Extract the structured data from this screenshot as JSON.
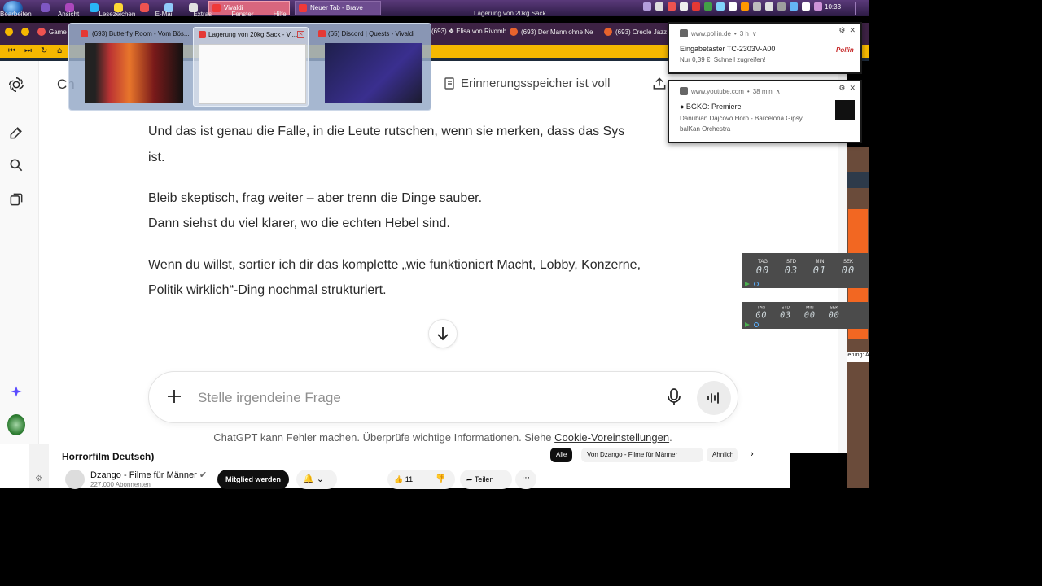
{
  "taskbar": {
    "menu": [
      "Bearbeiten",
      "Ansicht",
      "Lesezeichen",
      "E-Mail",
      "Extras",
      "Fenster",
      "Hilfe"
    ],
    "tasks": [
      {
        "label": "Vivaldi",
        "active": true
      },
      {
        "label": "Neuer Tab - Brave",
        "active": false
      }
    ],
    "window_title": "Lagerung von 20kg Sack",
    "clock": "10:33"
  },
  "browser_tabs": [
    "Game",
    "(693) ❖ Elisa von Rivomb",
    "(693) Der Mann ohne Ne",
    "(693) Creole Jazz F"
  ],
  "tab_preview": [
    {
      "title": "(693) Butterfly Room - Vom Bös...",
      "selected": false
    },
    {
      "title": "Lagerung von 20kg Sack - Vi...",
      "selected": true
    },
    {
      "title": "(65) Discord | Quests - Vivaldi",
      "selected": false
    }
  ],
  "chat": {
    "title_fragment": "Ch",
    "memory_label": "Erinnerungsspeicher ist voll",
    "paragraphs": [
      "Und das ist genau die Falle, in die Leute rutschen, wenn sie merken, dass das Sys",
      "ist.",
      "Bleib skeptisch, frag weiter – aber trenn die Dinge sauber.",
      "Dann siehst du viel klarer, wo die echten Hebel sind.",
      "Wenn du willst, sortier ich dir das komplette „wie funktioniert Macht, Lobby, Konzerne,",
      "Politik wirklich“-Ding nochmal strukturiert."
    ],
    "composer_placeholder": "Stelle irgendeine Frage",
    "disclaimer": "ChatGPT kann Fehler machen. Überprüfe wichtige Informationen. Siehe ",
    "disclaimer_link": "Cookie-Voreinstellungen",
    "disclaimer_end": "."
  },
  "notifications": [
    {
      "source": "www.pollin.de",
      "age": "3 h",
      "title": "Eingabetaster TC-2303V-A00",
      "body": "Nur 0,39 €. Schnell zugreifen!",
      "brand": "Pollin"
    },
    {
      "source": "www.youtube.com",
      "age": "38 min",
      "title": "● BGKO: Premiere",
      "body": "Danubian Dajčovo Horo - Barcelona Gipsy balKan Orchestra"
    }
  ],
  "timers": [
    {
      "labels": [
        "TAG",
        "STD",
        "MIN",
        "SEK"
      ],
      "values": [
        "00",
        "03",
        "01",
        "00"
      ]
    },
    {
      "labels": [
        "TAG",
        "STD",
        "MIN",
        "SEK"
      ],
      "values": [
        "00",
        "03",
        "00",
        "00"
      ]
    }
  ],
  "youtube": {
    "video_title": "Horrorfilm Deutsch)",
    "channel": "Dzango - Filme für Männer",
    "subscribers": "227.000 Abonnenten",
    "join_label": "Mitglied werden",
    "likes": "11",
    "share_label": "Teilen",
    "chips": [
      "Alle",
      "Von Dzango - Filme für Männer",
      "Ahnlich"
    ]
  },
  "background_note": "lerung: A",
  "colors": {
    "taskbar": "#2d1b45",
    "address_bar": "#f5b800",
    "accent_orange": "#f26722",
    "chatgpt_text": "#2a2a2a"
  }
}
